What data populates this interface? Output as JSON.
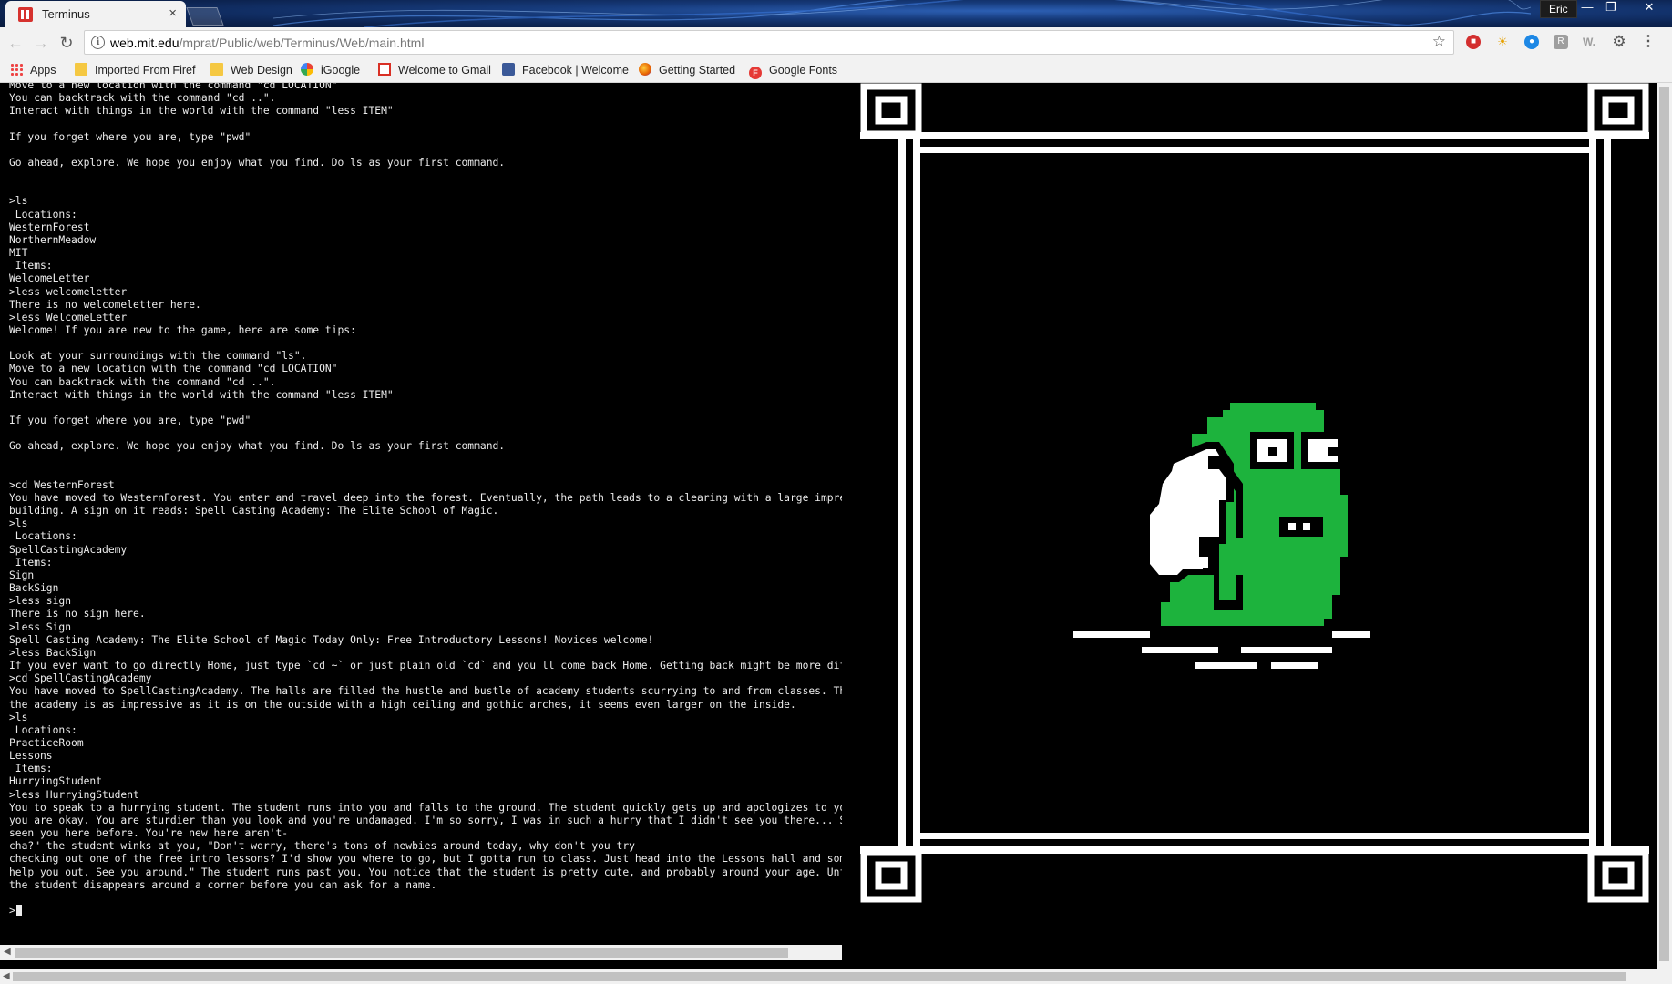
{
  "browser": {
    "tab_title": "Terminus",
    "tab_close": "×",
    "profile_name": "Eric",
    "window_controls": {
      "minimize": "—",
      "restore": "❐",
      "close": "✕"
    },
    "url_host": "web.mit.edu",
    "url_path": "/mprat/Public/web/Terminus/Web/main.html",
    "bookmarks": [
      {
        "label": "Apps",
        "icon": "apps-grid-icon"
      },
      {
        "label": "Imported From Firef",
        "icon": "folder-icon"
      },
      {
        "label": "Web Design",
        "icon": "folder-icon"
      },
      {
        "label": "iGoogle",
        "icon": "google-icon"
      },
      {
        "label": "Welcome to Gmail",
        "icon": "gmail-icon"
      },
      {
        "label": "Facebook | Welcome",
        "icon": "facebook-icon"
      },
      {
        "label": "Getting Started",
        "icon": "firefox-icon"
      },
      {
        "label": "Google Fonts",
        "icon": "google-fonts-icon"
      }
    ],
    "google_fonts_letter": "F",
    "extension_letter": "W."
  },
  "terminal": {
    "prompt": ">",
    "lines": [
      "Move to a new location with the command \"cd LOCATION\"",
      "You can backtrack with the command \"cd ..\".",
      "Interact with things in the world with the command \"less ITEM\"",
      "",
      "If you forget where you are, type \"pwd\"",
      "",
      "Go ahead, explore. We hope you enjoy what you find. Do ls as your first command.",
      "",
      "",
      ">ls",
      " Locations:",
      "WesternForest",
      "NorthernMeadow",
      "MIT",
      " Items:",
      "WelcomeLetter",
      ">less welcomeletter",
      "There is no welcomeletter here.",
      ">less WelcomeLetter",
      "Welcome! If you are new to the game, here are some tips:",
      "",
      "Look at your surroundings with the command \"ls\".",
      "Move to a new location with the command \"cd LOCATION\"",
      "You can backtrack with the command \"cd ..\".",
      "Interact with things in the world with the command \"less ITEM\"",
      "",
      "If you forget where you are, type \"pwd\"",
      "",
      "Go ahead, explore. We hope you enjoy what you find. Do ls as your first command.",
      "",
      "",
      ">cd WesternForest",
      "You have moved to WesternForest. You enter and travel deep into the forest. Eventually, the path leads to a clearing with a large impressiv",
      "building. A sign on it reads: Spell Casting Academy: The Elite School of Magic.",
      ">ls",
      " Locations:",
      "SpellCastingAcademy",
      " Items:",
      "Sign",
      "BackSign",
      ">less sign",
      "There is no sign here.",
      ">less Sign",
      "Spell Casting Academy: The Elite School of Magic Today Only: Free Introductory Lessons! Novices welcome!",
      ">less BackSign",
      "If you ever want to go directly Home, just type `cd ~` or just plain old `cd` and you'll come back Home. Getting back might be more difficu",
      ">cd SpellCastingAcademy",
      "You have moved to SpellCastingAcademy. The halls are filled the hustle and bustle of academy students scurrying to and from classes. The in",
      "the academy is as impressive as it is on the outside with a high ceiling and gothic arches, it seems even larger on the inside.",
      ">ls",
      " Locations:",
      "PracticeRoom",
      "Lessons",
      " Items:",
      "HurryingStudent",
      ">less HurryingStudent",
      "You to speak to a hurrying student. The student runs into you and falls to the ground. The student quickly gets up and apologizes to you, a",
      "you are okay. You are sturdier than you look and you're undamaged. I'm so sorry, I was in such a hurry that I didn't see you there... Say,",
      "seen you here before. You're new here aren't-",
      "cha?\" the student winks at you, \"Don't worry, there's tons of newbies around today, why don't you try",
      "checking out one of the free intro lessons? I'd show you where to go, but I gotta run to class. Just head into the Lessons hall and someone",
      "help you out. See you around.\" The student runs past you. You notice that the student is pretty cute, and probably around your age. Unfortu",
      "the student disappears around a corner before you can ask for a name."
    ]
  },
  "colors": {
    "creature_green": "#1db33d",
    "frame": "#ffffff",
    "background": "#000000"
  },
  "picture": {
    "subject": "pixel-art green hooded creature with white sack in a greek-key frame"
  }
}
